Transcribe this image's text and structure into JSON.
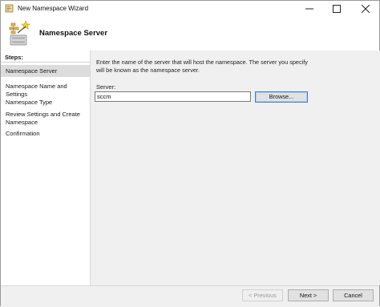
{
  "window": {
    "title": "New Namespace Wizard",
    "controls": {
      "minimize_icon": "minimize-icon",
      "maximize_icon": "maximize-icon",
      "close_icon": "close-icon"
    }
  },
  "header": {
    "title": "Namespace Server",
    "icon": "namespace-wizard-icon"
  },
  "steps": {
    "heading": "Steps:",
    "items": [
      {
        "label": "Namespace Server",
        "active": true
      },
      {
        "label": "Namespace Name and Settings",
        "active": false
      },
      {
        "label": "Namespace Type",
        "active": false
      },
      {
        "label": "Review Settings and Create Namespace",
        "active": false
      },
      {
        "label": "Confirmation",
        "active": false
      }
    ]
  },
  "main": {
    "instruction": "Enter the name of the server that will host the namespace. The server you specify will be known as the namespace server.",
    "server_label": "Server:",
    "server_value": "sccm",
    "browse_label": "Browse..."
  },
  "footer": {
    "previous_label": "< Previous",
    "next_label": "Next >",
    "cancel_label": "Cancel"
  },
  "colors": {
    "content_bg": "#f0f0f0",
    "active_step_bg": "#dcdcdc",
    "focus_border": "#3c7fd0"
  }
}
